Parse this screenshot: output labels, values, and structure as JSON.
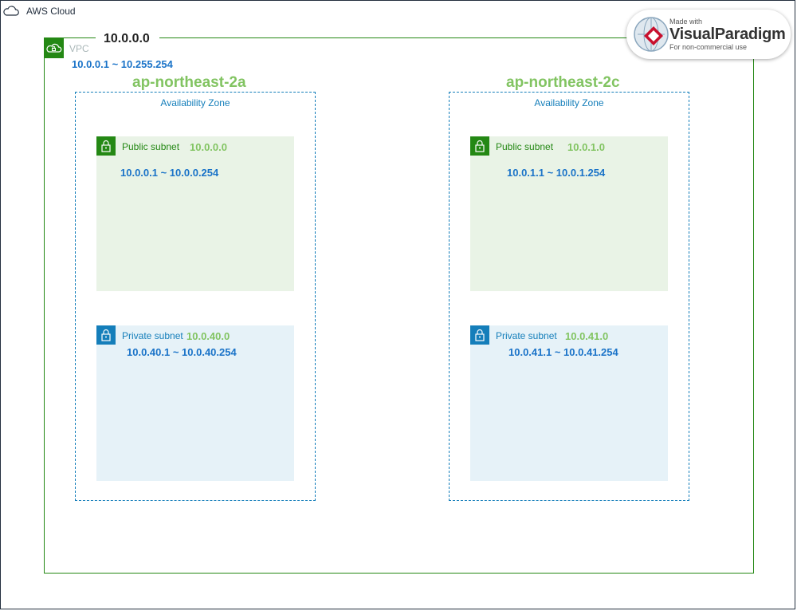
{
  "aws_cloud": {
    "label": "AWS Cloud",
    "icon": "cloud-icon"
  },
  "vpc": {
    "label": "VPC",
    "cidr": "10.0.0.0",
    "range": "10.0.0.1 ~ 10.255.254",
    "icon": "vpc-cloud-lock-icon",
    "color": "#248814"
  },
  "zones": [
    {
      "name": "ap-northeast-2a",
      "label": "Availability Zone",
      "public": {
        "label": "Public subnet",
        "cidr": "10.0.0.0",
        "range": "10.0.0.1 ~ 10.0.0.254"
      },
      "private": {
        "label": "Private subnet",
        "cidr": "10.0.40.0",
        "range": "10.0.40.1 ~ 10.0.40.254"
      }
    },
    {
      "name": "ap-northeast-2c",
      "label": "Availability Zone",
      "public": {
        "label": "Public subnet",
        "cidr": "10.0.1.0",
        "range": "10.0.1.1 ~ 10.0.1.254"
      },
      "private": {
        "label": "Private subnet",
        "cidr": "10.0.41.0",
        "range": "10.0.41.1 ~ 10.0.41.254"
      }
    }
  ],
  "colors": {
    "zone_name": "#82c462",
    "range_text": "#1a73c8",
    "public_fill": "#e9f3e6",
    "private_fill": "#e6f2f8"
  },
  "watermark": {
    "made_with": "Made with",
    "brand_a": "Visual",
    "brand_b": "Paradigm",
    "subtitle": "For non-commercial use"
  }
}
